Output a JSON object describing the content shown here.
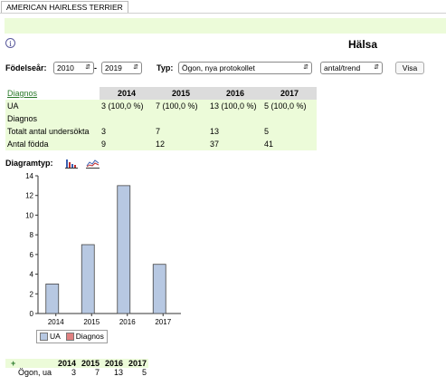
{
  "tab": {
    "label": "AMERICAN HAIRLESS TERRIER"
  },
  "header": {
    "title": "Hälsa"
  },
  "filters": {
    "birth_year_label": "Födelseår:",
    "year_from": "2010",
    "dash": "-",
    "year_to": "2019",
    "type_label": "Typ:",
    "type_value": "Ögon, nya protokollet",
    "mode_value": "antal/trend",
    "show_button": "Visa"
  },
  "table": {
    "corner": "Diagnos",
    "years": [
      "2014",
      "2015",
      "2016",
      "2017"
    ],
    "rows": [
      {
        "label": "UA",
        "cells": [
          "3  (100,0 %)",
          "7  (100,0 %)",
          "13  (100,0 %)",
          "5  (100,0 %)"
        ]
      },
      {
        "label": "Diagnos",
        "cells": [
          "",
          "",
          "",
          ""
        ]
      },
      {
        "label": "Totalt antal undersökta",
        "cells": [
          "3",
          "7",
          "13",
          "5"
        ]
      },
      {
        "label": "Antal födda",
        "cells": [
          "9",
          "12",
          "37",
          "41"
        ]
      }
    ]
  },
  "diagram": {
    "label": "Diagramtyp:"
  },
  "chart_data": {
    "type": "bar",
    "categories": [
      "2014",
      "2015",
      "2016",
      "2017"
    ],
    "series": [
      {
        "name": "UA",
        "values": [
          3,
          7,
          13,
          5
        ]
      },
      {
        "name": "Diagnos",
        "values": [
          0,
          0,
          0,
          0
        ]
      }
    ],
    "ylim": [
      0,
      14
    ],
    "yticks": [
      "0",
      "2",
      "4",
      "6",
      "8",
      "10",
      "12",
      "14"
    ],
    "colors": {
      "UA": "#b7c8e2",
      "Diagnos": "#e08080"
    },
    "grid": false,
    "legend": "bottom-left"
  },
  "bottom_table": {
    "plus": "+",
    "years": [
      "2014",
      "2015",
      "2016",
      "2017"
    ],
    "row_label": "Ögon, ua",
    "values": [
      "3",
      "7",
      "13",
      "5"
    ]
  }
}
